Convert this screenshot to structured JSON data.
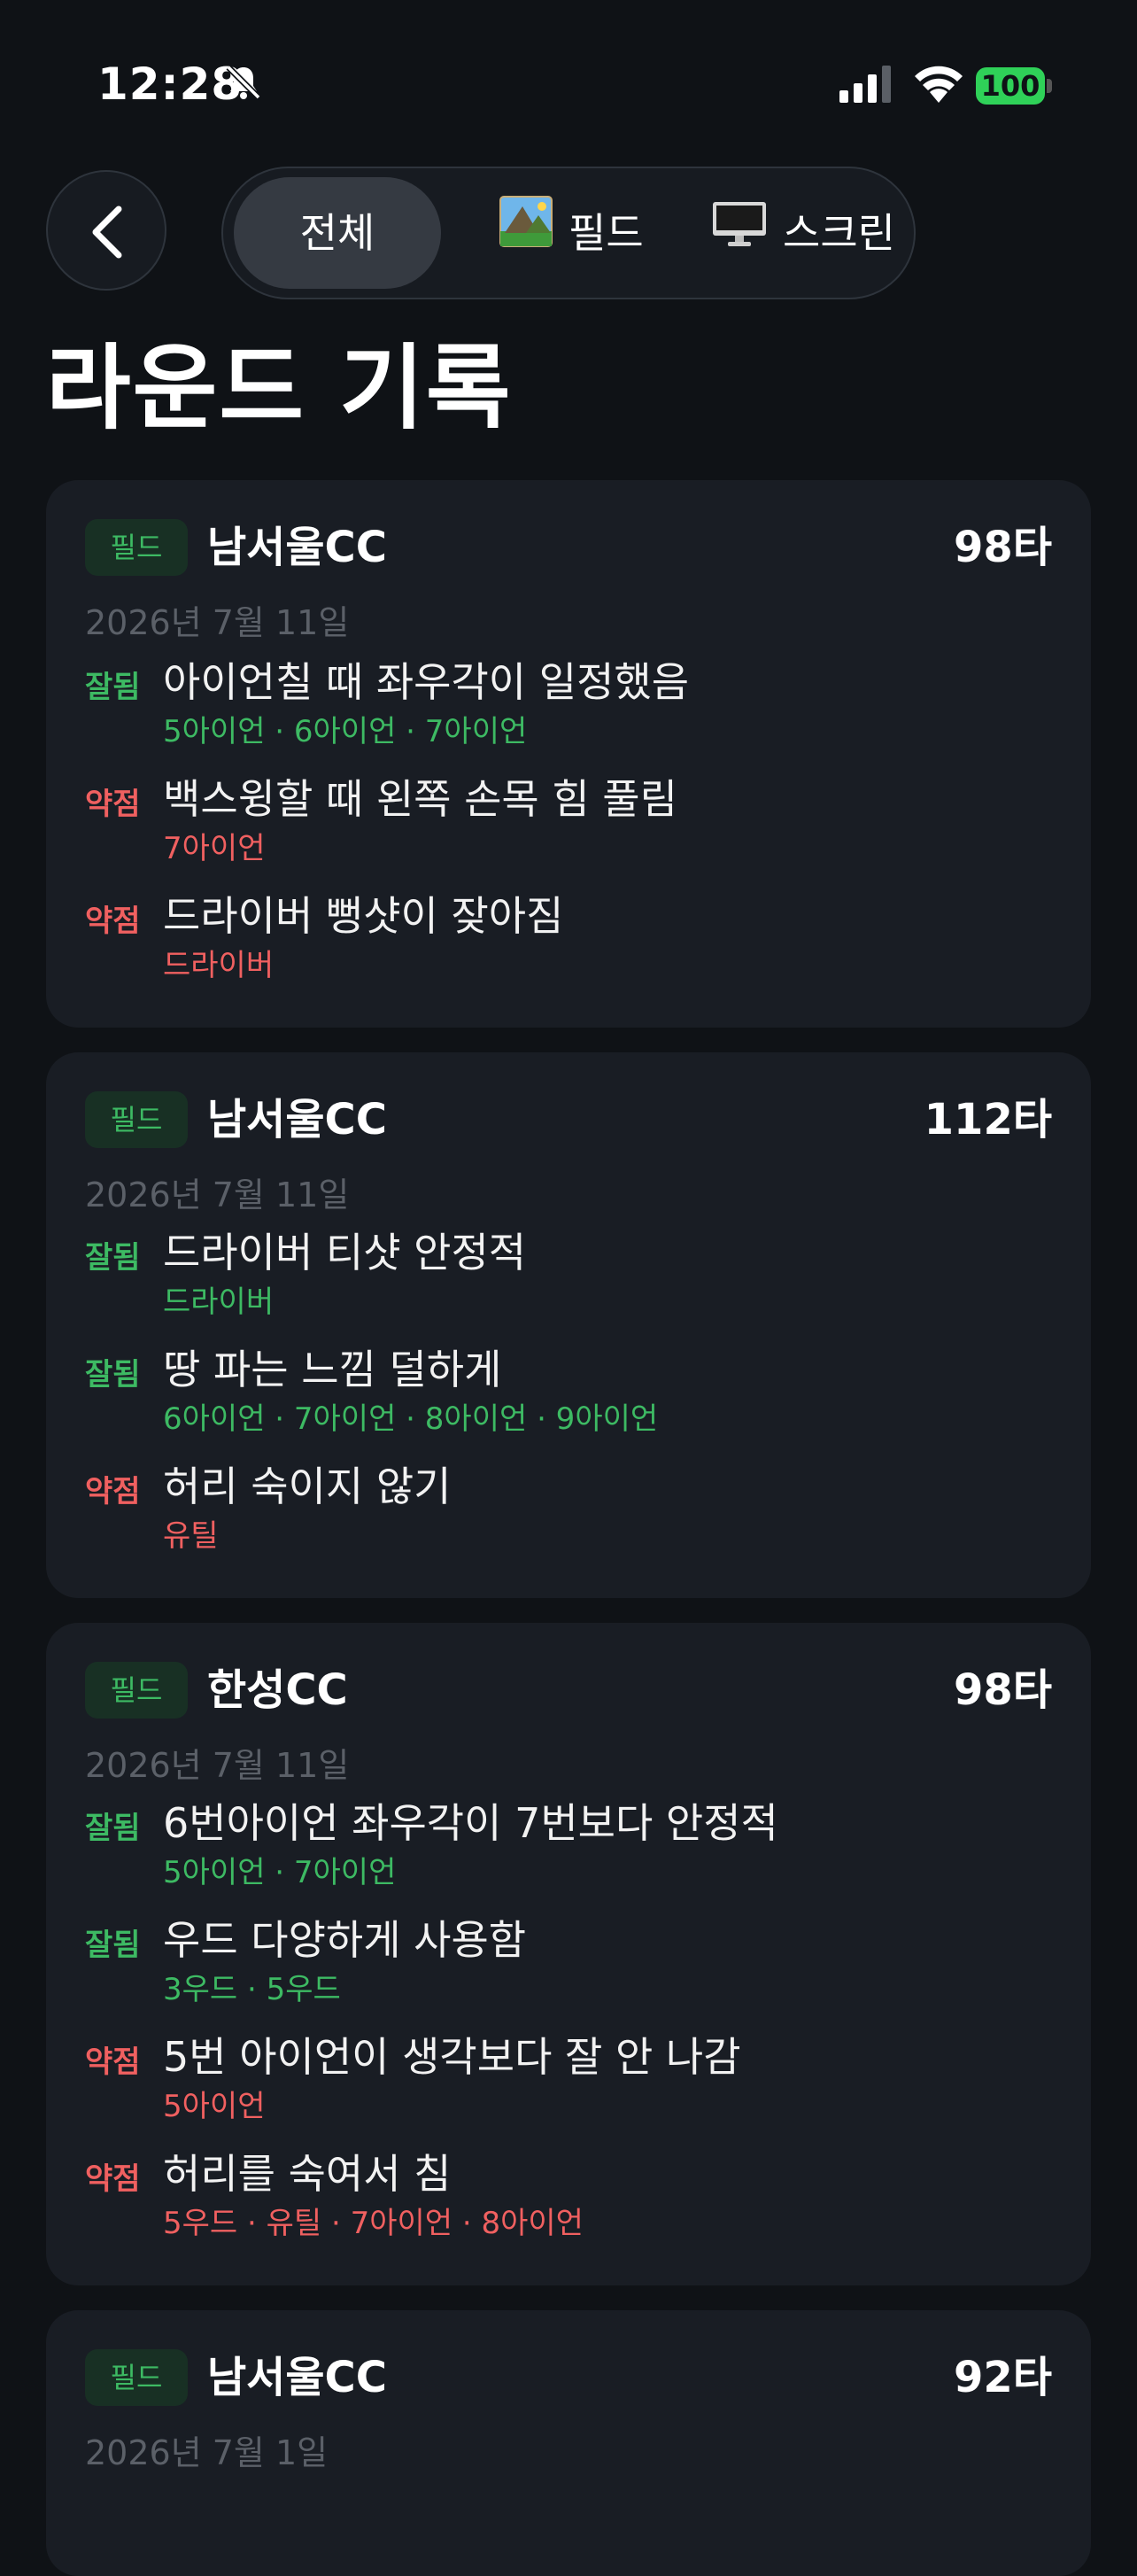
{
  "status": {
    "time": "12:28",
    "battery": "100",
    "icons": [
      "bell-slash-icon",
      "signal-icon",
      "wifi-icon",
      "battery-icon"
    ]
  },
  "nav": {
    "back_icon": "chevron-left-icon",
    "tabs": [
      {
        "label": "전체",
        "selected": true
      },
      {
        "label": "필드",
        "icon": "landscape-picture-icon"
      },
      {
        "label": "스크린",
        "icon": "desktop-computer-icon"
      }
    ]
  },
  "page": {
    "title": "라운드 기록"
  },
  "colors": {
    "good": "#3dba63",
    "weak": "#f06060",
    "card": "#191d24",
    "background": "#0f1216"
  },
  "rounds": [
    {
      "badge": "필드",
      "course": "남서울CC",
      "score": "98타",
      "date": "2026년 7월 11일",
      "notes": [
        {
          "tag": "잘됨",
          "type": "good",
          "text": "아이언칠 때 좌우각이 일정했음",
          "clubs": "5아이언 · 6아이언 · 7아이언"
        },
        {
          "tag": "약점",
          "type": "weak",
          "text": "백스윙할 때 왼쪽 손목 힘 풀림",
          "clubs": "7아이언"
        },
        {
          "tag": "약점",
          "type": "weak",
          "text": "드라이버 뻥샷이 잦아짐",
          "clubs": "드라이버"
        }
      ]
    },
    {
      "badge": "필드",
      "course": "남서울CC",
      "score": "112타",
      "date": "2026년 7월 11일",
      "notes": [
        {
          "tag": "잘됨",
          "type": "good",
          "text": "드라이버 티샷 안정적",
          "clubs": "드라이버"
        },
        {
          "tag": "잘됨",
          "type": "good",
          "text": "땅 파는 느낌 덜하게",
          "clubs": "6아이언 · 7아이언 · 8아이언 · 9아이언"
        },
        {
          "tag": "약점",
          "type": "weak",
          "text": "허리 숙이지 않기",
          "clubs": "유틸"
        }
      ]
    },
    {
      "badge": "필드",
      "course": "한성CC",
      "score": "98타",
      "date": "2026년 7월 11일",
      "notes": [
        {
          "tag": "잘됨",
          "type": "good",
          "text": "6번아이언 좌우각이 7번보다 안정적",
          "clubs": "5아이언 · 7아이언"
        },
        {
          "tag": "잘됨",
          "type": "good",
          "text": "우드 다양하게 사용함",
          "clubs": "3우드 · 5우드"
        },
        {
          "tag": "약점",
          "type": "weak",
          "text": "5번 아이언이 생각보다 잘 안 나감",
          "clubs": "5아이언"
        },
        {
          "tag": "약점",
          "type": "weak",
          "text": "허리를 숙여서 침",
          "clubs": "5우드 · 유틸 · 7아이언 · 8아이언"
        }
      ]
    },
    {
      "badge": "필드",
      "course": "남서울CC",
      "score": "92타",
      "date": "2026년 7월 1일",
      "notes": []
    }
  ]
}
